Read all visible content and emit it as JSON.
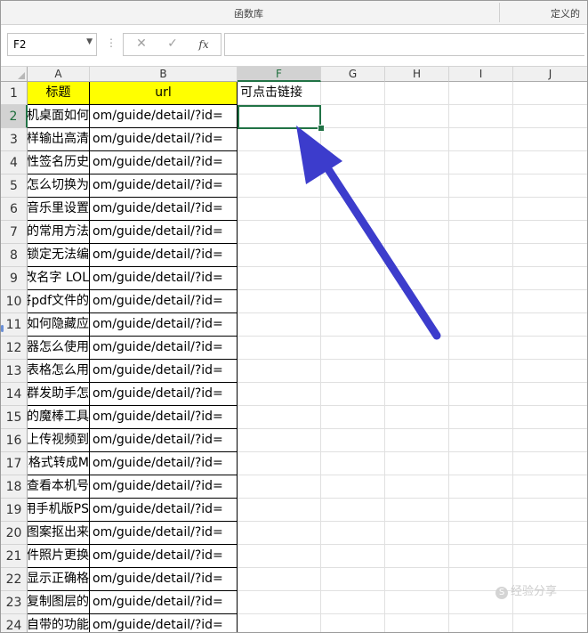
{
  "ribbon": {
    "group_label": "函数库",
    "right_label": "定义的"
  },
  "formula_bar": {
    "name_box": "F2",
    "cancel_glyph": "✕",
    "enter_glyph": "✓",
    "fx_label": "fx",
    "formula_value": ""
  },
  "columns": [
    {
      "label": "A",
      "selected": false
    },
    {
      "label": "B",
      "selected": false
    },
    {
      "label": "F",
      "selected": true
    },
    {
      "label": "G",
      "selected": false
    },
    {
      "label": "H",
      "selected": false
    },
    {
      "label": "I",
      "selected": false
    },
    {
      "label": "J",
      "selected": false
    }
  ],
  "header_row": {
    "row": "1",
    "a": "标题",
    "b": "url",
    "f": "可点击链接"
  },
  "rows": [
    {
      "row": "2",
      "a": "iPhone手机桌面如何",
      "b": "om/guide/detail/?id="
    },
    {
      "row": "3",
      "a": "PPT怎样输出高清",
      "b": "om/guide/detail/?id="
    },
    {
      "row": "4",
      "a": "QQ个性签名历史",
      "b": "om/guide/detail/?id="
    },
    {
      "row": "5",
      "a": "输入法怎么切换为",
      "b": "om/guide/detail/?id="
    },
    {
      "row": "6",
      "a": "酷狗音乐里设置",
      "b": "om/guide/detail/?id="
    },
    {
      "row": "7",
      "a": "PS中的常用方法",
      "b": "om/guide/detail/?id="
    },
    {
      "row": "8",
      "a": "文档被锁定无法编",
      "b": "om/guide/detail/?id="
    },
    {
      "row": "9",
      "a": "怎么改名字 LOL",
      "b": "om/guide/detail/?id="
    },
    {
      "row": "10",
      "a": "如何将pdf文件的",
      "b": "om/guide/detail/?id="
    },
    {
      "row": "11",
      "a": "华为手机如何隐藏应",
      "b": "om/guide/detail/?id="
    },
    {
      "row": "12",
      "a": "浏览器怎么使用",
      "b": "om/guide/detail/?id="
    },
    {
      "row": "13",
      "a": "Excel表格怎么用",
      "b": "om/guide/detail/?id="
    },
    {
      "row": "14",
      "a": "微信群发助手怎",
      "b": "om/guide/detail/?id="
    },
    {
      "row": "15",
      "a": "PS中的魔棒工具",
      "b": "om/guide/detail/?id="
    },
    {
      "row": "16",
      "a": "手机上传视频到",
      "b": "om/guide/detail/?id="
    },
    {
      "row": "17",
      "a": "视频格式转成M",
      "b": "om/guide/detail/?id="
    },
    {
      "row": "18",
      "a": "怎么查看本机号",
      "b": "om/guide/detail/?id="
    },
    {
      "row": "19",
      "a": "如何用手机版PS",
      "b": "om/guide/detail/?id="
    },
    {
      "row": "20",
      "a": "PS图案抠出来",
      "b": "om/guide/detail/?id="
    },
    {
      "row": "21",
      "a": "证件照片更换",
      "b": "om/guide/detail/?id="
    },
    {
      "row": "22",
      "a": "不能显示正确格",
      "b": "om/guide/detail/?id="
    },
    {
      "row": "23",
      "a": "PS复制图层的",
      "b": "om/guide/detail/?id="
    },
    {
      "row": "24",
      "a": "手机自带的功能",
      "b": "om/guide/detail/?id="
    }
  ],
  "watermark": "经验分享",
  "colors": {
    "header_fill": "#ffff00",
    "selection": "#217346",
    "arrow": "#3c3ccc"
  }
}
